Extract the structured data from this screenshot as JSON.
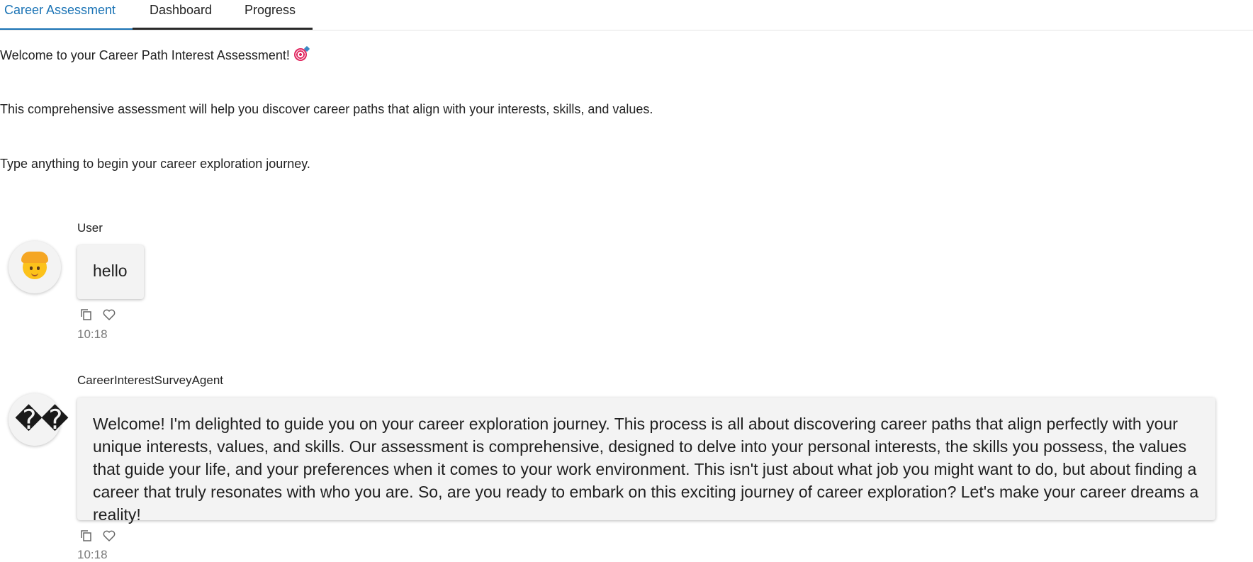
{
  "tabs": [
    {
      "label": "Career Assessment",
      "active": true
    },
    {
      "label": "Dashboard",
      "active": false
    },
    {
      "label": "Progress",
      "active": false
    }
  ],
  "intro": {
    "welcome": "Welcome to your Career Path Interest Assessment!",
    "welcome_emoji": "target-emoji",
    "description": "This comprehensive assessment will help you discover career paths that align with your interests, skills, and values.",
    "prompt": "Type anything to begin your career exploration journey."
  },
  "messages": [
    {
      "sender": "User",
      "avatar": "person-emoji",
      "text": "hello",
      "time": "10:18"
    },
    {
      "sender": "CareerInterestSurveyAgent",
      "avatar_text": "��",
      "text": "Welcome! I'm delighted to guide you on your career exploration journey. This process is all about discovering career paths that align perfectly with your unique interests, values, and skills. Our assessment is comprehensive, designed to delve into your personal interests, the skills you possess, the values that guide your life, and your preferences when it comes to your work environment. This isn't just about what job you might want to do, but about finding a career that truly resonates with who you are. So, are you ready to embark on this exciting journey of career exploration? Let's make your career dreams a reality!",
      "time": "10:18"
    }
  ],
  "icons": {
    "copy": "copy-icon",
    "like": "heart-icon"
  },
  "colors": {
    "accent": "#1a73b5",
    "bubble_bg": "#f3f3f3",
    "timestamp": "#7a7a7a"
  }
}
